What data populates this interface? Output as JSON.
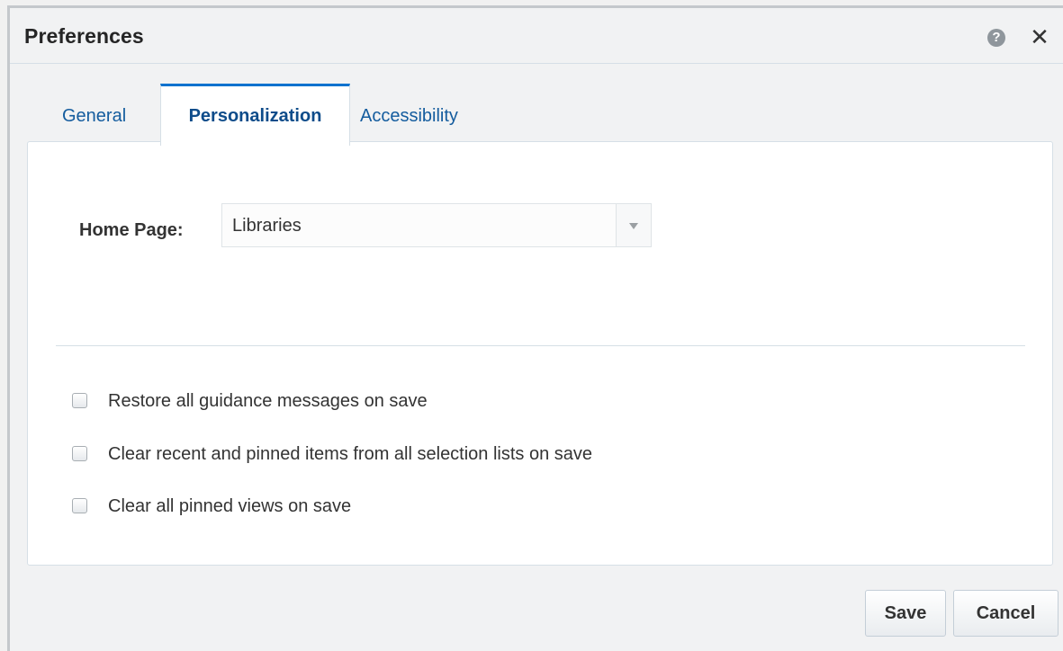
{
  "dialog": {
    "title": "Preferences",
    "help_icon": "help-icon",
    "close_icon": "close-icon",
    "help_glyph": "?",
    "close_glyph": "✕"
  },
  "tabs": [
    {
      "label": "General",
      "active": false
    },
    {
      "label": "Personalization",
      "active": true
    },
    {
      "label": "Accessibility",
      "active": false
    }
  ],
  "personalization": {
    "home_page_label": "Home Page:",
    "home_page_value": "Libraries",
    "options": [
      {
        "label": "Restore all guidance messages on save",
        "checked": false
      },
      {
        "label": "Clear recent and pinned items from all selection lists on save",
        "checked": false
      },
      {
        "label": "Clear all pinned views on save",
        "checked": false
      }
    ]
  },
  "footer": {
    "save_label": "Save",
    "cancel_label": "Cancel"
  },
  "colors": {
    "accent": "#0572ce",
    "active_tab_text": "#0e4c8a",
    "link_text": "#145c9e"
  }
}
